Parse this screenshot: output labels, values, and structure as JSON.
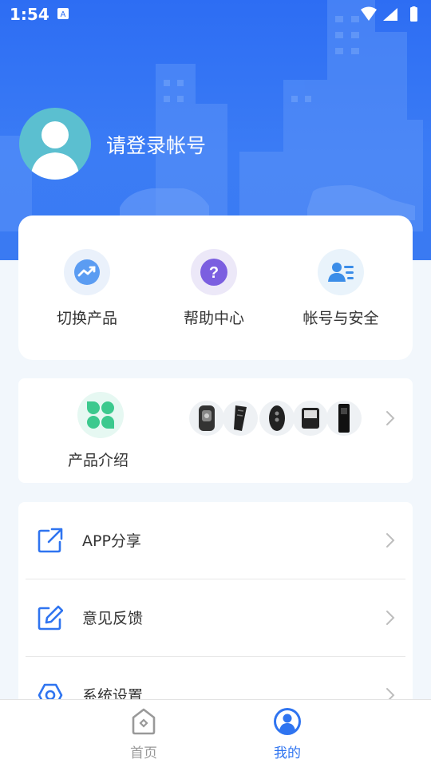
{
  "status_bar": {
    "time": "1:54"
  },
  "profile": {
    "login_prompt": "请登录帐号"
  },
  "quick_actions": [
    {
      "label": "切换产品",
      "icon": "switch-product-icon",
      "bg": "#eaf1fb",
      "color": "#4a8ff0"
    },
    {
      "label": "帮助中心",
      "icon": "help-icon",
      "bg": "#ece8f8",
      "color": "#7b5fe0"
    },
    {
      "label": "帐号与安全",
      "icon": "account-security-icon",
      "bg": "#e9f3fb",
      "color": "#3b8de8"
    }
  ],
  "product_intro": {
    "label": "产品介绍",
    "icon": "clover-icon",
    "color": "#3cc98e"
  },
  "menu": [
    {
      "label": "APP分享",
      "icon": "share-icon"
    },
    {
      "label": "意见反馈",
      "icon": "feedback-icon"
    },
    {
      "label": "系统设置",
      "icon": "settings-icon"
    }
  ],
  "tabbar": {
    "tabs": [
      {
        "label": "首页",
        "icon": "home-icon",
        "active": false
      },
      {
        "label": "我的",
        "icon": "profile-icon",
        "active": true
      }
    ],
    "active_color": "#2f74f0",
    "inactive_color": "#999999"
  },
  "colors": {
    "header": "#2f70f3",
    "accent": "#2f74f0"
  }
}
